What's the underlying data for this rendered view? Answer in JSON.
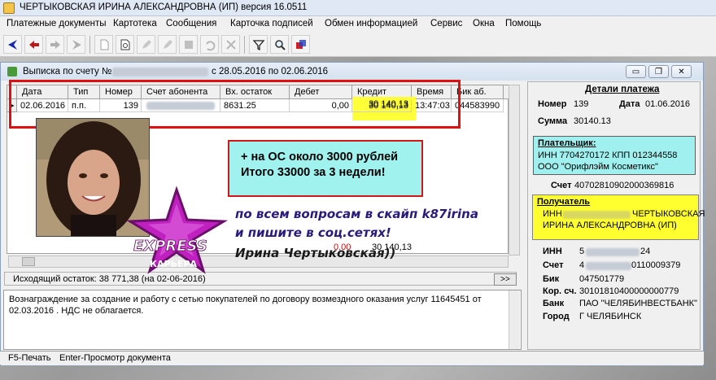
{
  "app": {
    "title": "ЧЕРТЫКОВСКАЯ ИРИНА АЛЕКСАНДРОВНА (ИП)  версия 16.0511"
  },
  "menu": [
    "Платежные документы",
    "Картотека",
    "Сообщения",
    "Карточка подписей",
    "Обмен информацией",
    "Сервис",
    "Окна",
    "Помощь"
  ],
  "window": {
    "title_prefix": "Выписка по счету №",
    "title_suffix": "с 28.05.2016 по 02.06.2016",
    "min_glyph": "▭",
    "restore_glyph": "❐",
    "close_glyph": "✕"
  },
  "grid": {
    "columns": [
      "Дата",
      "Тип",
      "Номер",
      "Счет абонента",
      "Вх. остаток",
      "Дебет",
      "Кредит",
      "Время",
      "Бик аб."
    ],
    "row": {
      "date": "02.06.2016",
      "type": "п.п.",
      "number": "139",
      "incoming": "8631.25",
      "debit": "0,00",
      "credit": "30 140,13",
      "time": "13:47:03",
      "bik": "044583990"
    },
    "totals": {
      "debit": "0,00",
      "credit": "30 140,13"
    }
  },
  "balance": {
    "text": "Исходящий остаток: 38 771,38  (на 02-06-2016)",
    "nav_label": ">>"
  },
  "description": "Вознаграждение за создание и работу с сетью покупателей по договору возмездного оказания услуг 11645451 от 02.03.2016 . НДС не облагается.",
  "details": {
    "title": "Детали платежа",
    "number_label": "Номер",
    "number": "139",
    "date_label": "Дата",
    "date": "01.06.2016",
    "sum_label": "Сумма",
    "sum": "30140.13",
    "payer_label": "Плательщик:",
    "payer_inn_kpp": "ИНН 7704270172 КПП 012344558",
    "payer_name": "ООО \"Орифлэйм Косметикс\"",
    "account_label": "Счет",
    "payer_account": "40702810902000369816",
    "recipient_label": "Получатель",
    "recipient_line1_prefix": "ИНН",
    "recipient_line1_suffix": "ЧЕРТЫКОВСКАЯ",
    "recipient_line2": "ИРИНА АЛЕКСАНДРОВНА (ИП)",
    "inn_label": "ИНН",
    "inn_prefix": "5",
    "inn_suffix": "24",
    "acc_label": "Счет",
    "acc_prefix": "4",
    "acc_suffix": "0110009379",
    "bik_label": "Бик",
    "bik": "047501779",
    "kor_label": "Кор. сч.",
    "kor": "30101810400000000779",
    "bank_label": "Банк",
    "bank": "ПАО \"ЧЕЛЯБИНВЕСТБАНК\"",
    "city_label": "Город",
    "city": "Г ЧЕЛЯБИНСК"
  },
  "statusbar": {
    "print": "F5-Печать",
    "view": "Enter-Просмотр документа"
  },
  "overlay": {
    "note_line1": "+ на ОС около 3000 рублей",
    "note_line2": "Итого 33000 за 3 недели!",
    "promo_line1": "по всем вопросам в скайп k87irina",
    "promo_line2": "и пишите в соц.сетях!",
    "signature": "Ирина Чертыковская))",
    "logo_word": "EXPRESS",
    "logo_sub": "КАРЬЕРА"
  },
  "colors": {
    "highlight_yellow": "#ffff3a",
    "payer_cyan": "#9ff0ef",
    "annotation_red": "#e01010",
    "logo_magenta": "#c020c0"
  }
}
